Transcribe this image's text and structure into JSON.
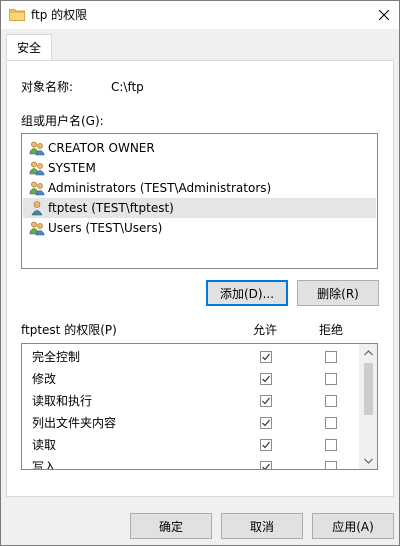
{
  "window": {
    "title": "ftp 的权限"
  },
  "tabs": [
    {
      "label": "安全"
    }
  ],
  "object": {
    "label": "对象名称:",
    "value": "C:\\ftp"
  },
  "groups": {
    "label": "组或用户名(G):",
    "items": [
      {
        "name": "CREATOR OWNER",
        "icon": "users-group-icon"
      },
      {
        "name": "SYSTEM",
        "icon": "users-group-icon"
      },
      {
        "name": "Administrators (TEST\\Administrators)",
        "icon": "users-group-icon"
      },
      {
        "name": "ftptest (TEST\\ftptest)",
        "icon": "single-user-icon",
        "selected": true
      },
      {
        "name": "Users (TEST\\Users)",
        "icon": "users-group-icon"
      }
    ],
    "add_button": "添加(D)...",
    "remove_button": "删除(R)"
  },
  "permissions": {
    "label": "ftptest 的权限(P)",
    "allow_header": "允许",
    "deny_header": "拒绝",
    "rows": [
      {
        "name": "完全控制",
        "allow": true,
        "deny": false
      },
      {
        "name": "修改",
        "allow": true,
        "deny": false
      },
      {
        "name": "读取和执行",
        "allow": true,
        "deny": false
      },
      {
        "name": "列出文件夹内容",
        "allow": true,
        "deny": false
      },
      {
        "name": "读取",
        "allow": true,
        "deny": false
      },
      {
        "name": "写入",
        "allow": true,
        "deny": false
      }
    ]
  },
  "footer": {
    "ok": "确定",
    "cancel": "取消",
    "apply": "应用(A)"
  },
  "colors": {
    "accent": "#0078d7",
    "folder": "#f0c75e"
  }
}
